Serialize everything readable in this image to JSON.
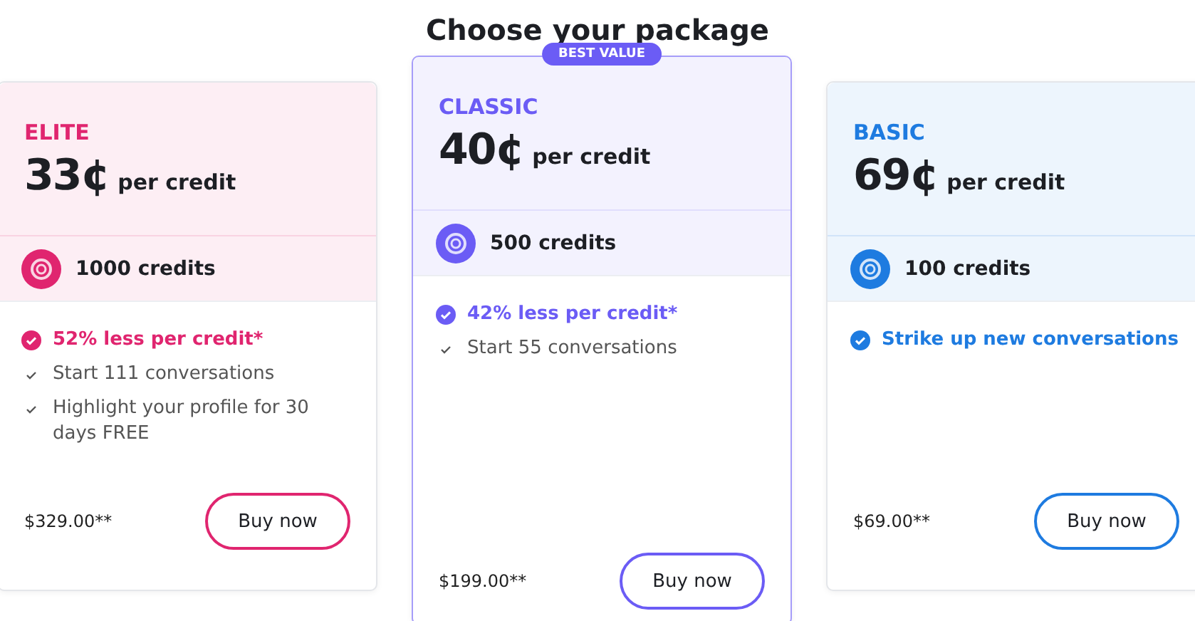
{
  "title": "Choose your package",
  "packages": [
    {
      "name": "ELITE",
      "price": "33¢",
      "unit": "per credit",
      "credits": "1000 credits",
      "color": "#e0256f",
      "featured": false,
      "features": [
        {
          "kind": "highlight",
          "text": "52% less per credit*"
        },
        {
          "kind": "plain",
          "text": "Start 111 conversations"
        },
        {
          "kind": "plain",
          "text": "Highlight your profile for 30 days FREE"
        }
      ],
      "total": "$329.00**",
      "button": "Buy now"
    },
    {
      "name": "CLASSIC",
      "badge": "BEST VALUE",
      "price": "40¢",
      "unit": "per credit",
      "credits": "500 credits",
      "color": "#6b5cf5",
      "featured": true,
      "features": [
        {
          "kind": "highlight",
          "text": "42% less per credit*"
        },
        {
          "kind": "plain",
          "text": "Start 55 conversations"
        }
      ],
      "total": "$199.00**",
      "button": "Buy now"
    },
    {
      "name": "BASIC",
      "price": "69¢",
      "unit": "per credit",
      "credits": "100 credits",
      "color": "#1e7be0",
      "featured": false,
      "features": [
        {
          "kind": "highlight",
          "text": "Strike up new conversations"
        }
      ],
      "total": "$69.00**",
      "button": "Buy now"
    }
  ]
}
